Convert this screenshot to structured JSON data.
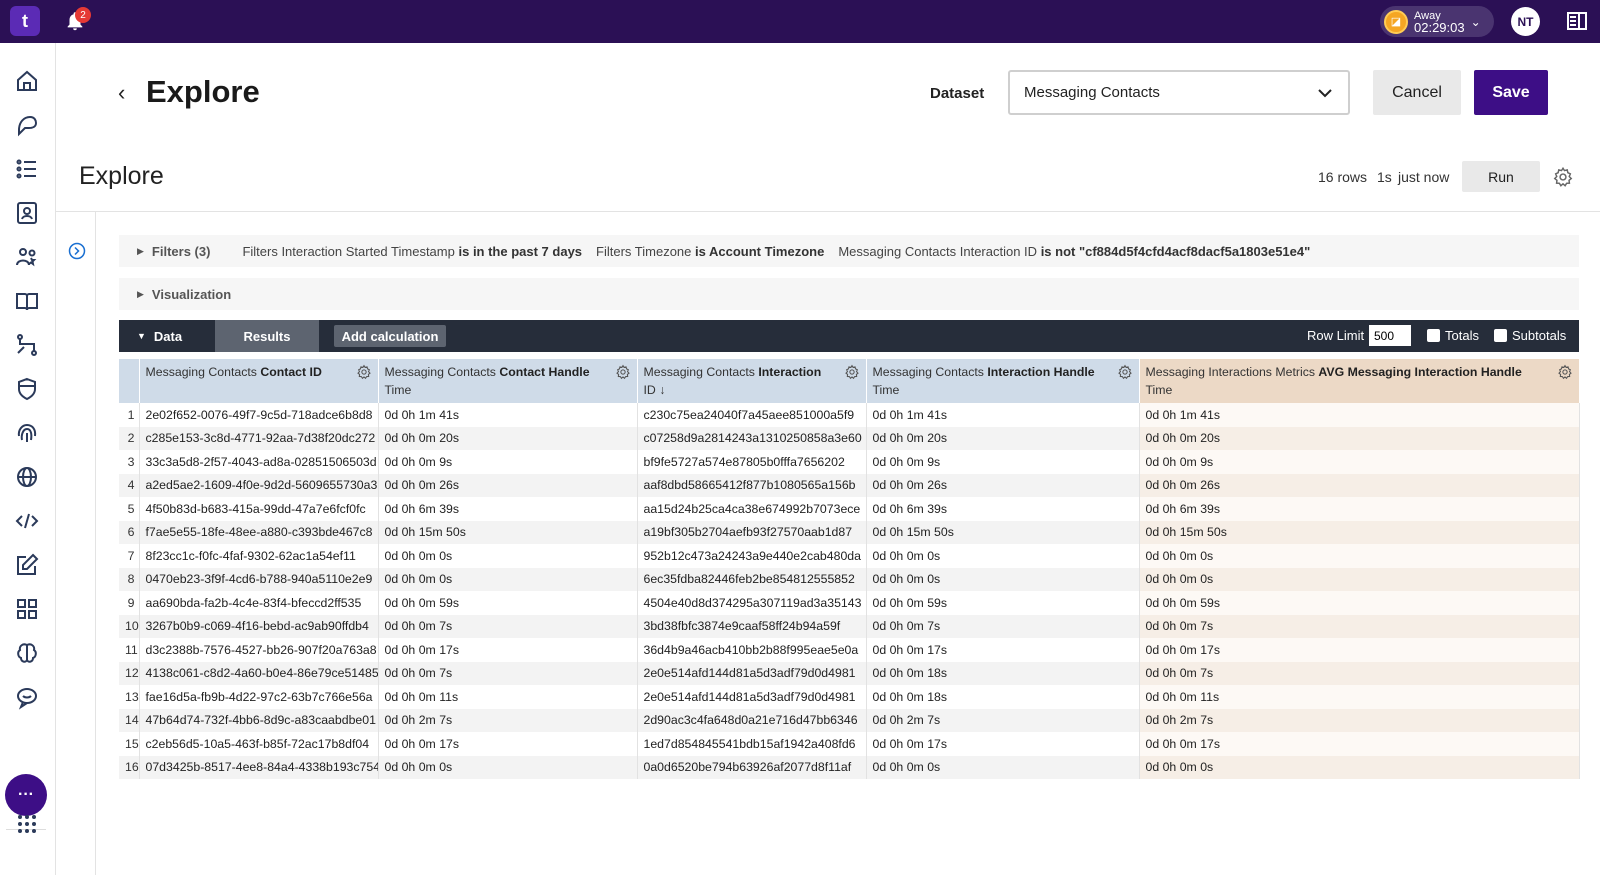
{
  "topbar": {
    "logo_text": "t",
    "notifications_count": "2",
    "status": {
      "label": "Away",
      "timer": "02:29:03"
    },
    "avatar_initials": "NT"
  },
  "header": {
    "title": "Explore",
    "dataset_label": "Dataset",
    "dataset_value": "Messaging Contacts",
    "cancel_label": "Cancel",
    "save_label": "Save"
  },
  "explore": {
    "title": "Explore",
    "rows": "16 rows",
    "duration": "1s",
    "updated": "just now",
    "run_label": "Run"
  },
  "filters": {
    "label": "Filters (3)",
    "items": [
      {
        "field": "Filters Interaction Started Timestamp",
        "condition": "is in the past 7 days"
      },
      {
        "field": "Filters Timezone",
        "condition": "is Account Timezone"
      },
      {
        "field": "Messaging Contacts Interaction ID",
        "condition": "is not \"cf884d5f4cfd4acf8dacf5a1803e51e4\""
      }
    ]
  },
  "visualization": {
    "label": "Visualization"
  },
  "databar": {
    "data_label": "Data",
    "results_label": "Results",
    "add_calc_label": "Add calculation",
    "row_limit_label": "Row Limit",
    "row_limit_value": "500",
    "totals_label": "Totals",
    "subtotals_label": "Subtotals"
  },
  "table": {
    "columns": [
      {
        "prefix": "Messaging Contacts",
        "name": "Contact ID",
        "line2": ""
      },
      {
        "prefix": "Messaging Contacts",
        "name": "Contact Handle",
        "line2": "Time"
      },
      {
        "prefix": "Messaging Contacts",
        "name": "Interaction",
        "line2": "ID ↓"
      },
      {
        "prefix": "Messaging Contacts",
        "name": "Interaction Handle",
        "line2": "Time"
      },
      {
        "prefix": "Messaging Interactions Metrics",
        "name": "AVG Messaging Interaction Handle",
        "line2": "Time"
      }
    ],
    "rows": [
      [
        "1",
        "2e02f652-0076-49f7-9c5d-718adce6b8d8",
        "0d 0h 1m 41s",
        "c230c75ea24040f7a45aee851000a5f9",
        "0d 0h 1m 41s",
        "0d 0h 1m 41s"
      ],
      [
        "2",
        "c285e153-3c8d-4771-92aa-7d38f20dc272",
        "0d 0h 0m 20s",
        "c07258d9a2814243a1310250858a3e60",
        "0d 0h 0m 20s",
        "0d 0h 0m 20s"
      ],
      [
        "3",
        "33c3a5d8-2f57-4043-ad8a-02851506503d",
        "0d 0h 0m 9s",
        "bf9fe5727a574e87805b0fffa7656202",
        "0d 0h 0m 9s",
        "0d 0h 0m 9s"
      ],
      [
        "4",
        "a2ed5ae2-1609-4f0e-9d2d-5609655730a3",
        "0d 0h 0m 26s",
        "aaf8dbd58665412f877b1080565a156b",
        "0d 0h 0m 26s",
        "0d 0h 0m 26s"
      ],
      [
        "5",
        "4f50b83d-b683-415a-99dd-47a7e6fcf0fc",
        "0d 0h 6m 39s",
        "aa15d24b25ca4ca38e674992b7073ece",
        "0d 0h 6m 39s",
        "0d 0h 6m 39s"
      ],
      [
        "6",
        "f7ae5e55-18fe-48ee-a880-c393bde467c8",
        "0d 0h 15m 50s",
        "a19bf305b2704aefb93f27570aab1d87",
        "0d 0h 15m 50s",
        "0d 0h 15m 50s"
      ],
      [
        "7",
        "8f23cc1c-f0fc-4faf-9302-62ac1a54ef11",
        "0d 0h 0m 0s",
        "952b12c473a24243a9e440e2cab480da",
        "0d 0h 0m 0s",
        "0d 0h 0m 0s"
      ],
      [
        "8",
        "0470eb23-3f9f-4cd6-b788-940a5110e2e9",
        "0d 0h 0m 0s",
        "6ec35fdba82446feb2be854812555852",
        "0d 0h 0m 0s",
        "0d 0h 0m 0s"
      ],
      [
        "9",
        "aa690bda-fa2b-4c4e-83f4-bfeccd2ff535",
        "0d 0h 0m 59s",
        "4504e40d8d374295a307119ad3a35143",
        "0d 0h 0m 59s",
        "0d 0h 0m 59s"
      ],
      [
        "10",
        "3267b0b9-c069-4f16-bebd-ac9ab90ffdb4",
        "0d 0h 0m 7s",
        "3bd38fbfc3874e9caaf58ff24b94a59f",
        "0d 0h 0m 7s",
        "0d 0h 0m 7s"
      ],
      [
        "11",
        "d3c2388b-7576-4527-bb26-907f20a763a8",
        "0d 0h 0m 17s",
        "36d4b9a46acb410bb2b88f995eae5e0a",
        "0d 0h 0m 17s",
        "0d 0h 0m 17s"
      ],
      [
        "12",
        "4138c061-c8d2-4a60-b0e4-86e79ce51485",
        "0d 0h 0m 7s",
        "2e0e514afd144d81a5d3adf79d0d4981",
        "0d 0h 0m 18s",
        "0d 0h 0m 7s"
      ],
      [
        "13",
        "fae16d5a-fb9b-4d22-97c2-63b7c766e56a",
        "0d 0h 0m 11s",
        "2e0e514afd144d81a5d3adf79d0d4981",
        "0d 0h 0m 18s",
        "0d 0h 0m 11s"
      ],
      [
        "14",
        "47b64d74-732f-4bb6-8d9c-a83caabdbe01",
        "0d 0h 2m 7s",
        "2d90ac3c4fa648d0a21e716d47bb6346",
        "0d 0h 2m 7s",
        "0d 0h 2m 7s"
      ],
      [
        "15",
        "c2eb56d5-10a5-463f-b85f-72ac17b8df04",
        "0d 0h 0m 17s",
        "1ed7d854845541bdb15af1942a408fd6",
        "0d 0h 0m 17s",
        "0d 0h 0m 17s"
      ],
      [
        "16",
        "07d3425b-8517-4ee8-84a4-4338b193c754",
        "0d 0h 0m 0s",
        "0a0d6520be794b63926af2077d8f11af",
        "0d 0h 0m 0s",
        "0d 0h 0m 0s"
      ]
    ]
  },
  "colors": {
    "topbar": "#2b1055",
    "primary": "#3d0e86",
    "dimension_header": "#cfdbe8",
    "measure_header": "#ecd9c6"
  },
  "nav_icons": [
    "home-icon",
    "chat-agent-icon",
    "list-icon",
    "contacts-icon",
    "team-icon",
    "knowledge-icon",
    "workflow-icon",
    "shield-icon",
    "fingerprint-icon",
    "globe-icon",
    "code-icon",
    "edit-icon",
    "apps-grid-icon",
    "brain-icon",
    "feedback-icon"
  ]
}
